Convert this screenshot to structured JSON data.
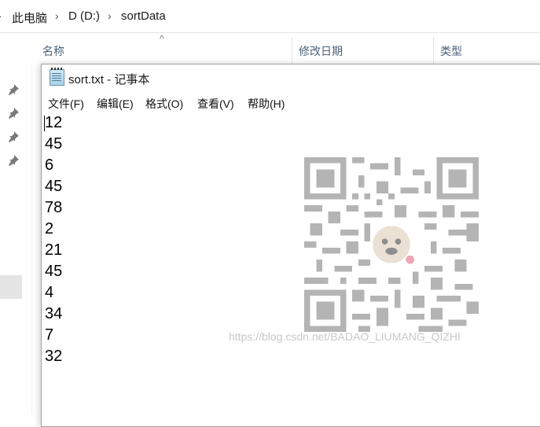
{
  "breadcrumb": {
    "items": [
      "此电脑",
      "D (D:)",
      "sortData"
    ]
  },
  "columns": [
    "名称",
    "修改日期",
    "类型"
  ],
  "notepad": {
    "title": "sort.txt - 记事本",
    "menu": [
      "文件(F)",
      "编辑(E)",
      "格式(O)",
      "查看(V)",
      "帮助(H)"
    ],
    "lines": [
      "12",
      "45",
      "6",
      "45",
      "78",
      "2",
      "21",
      "45",
      "4",
      "34",
      "7",
      "32"
    ]
  },
  "watermark": "https://blog.csdn.net/BADAO_LIUMANG_QIZHI",
  "colors": {
    "accent": "#4c607a",
    "border": "#a0a0a0"
  },
  "icons": [
    "chevron-right-icon",
    "pin-icon",
    "notepad-icon",
    "sort-up-icon",
    "qr-code-icon"
  ]
}
